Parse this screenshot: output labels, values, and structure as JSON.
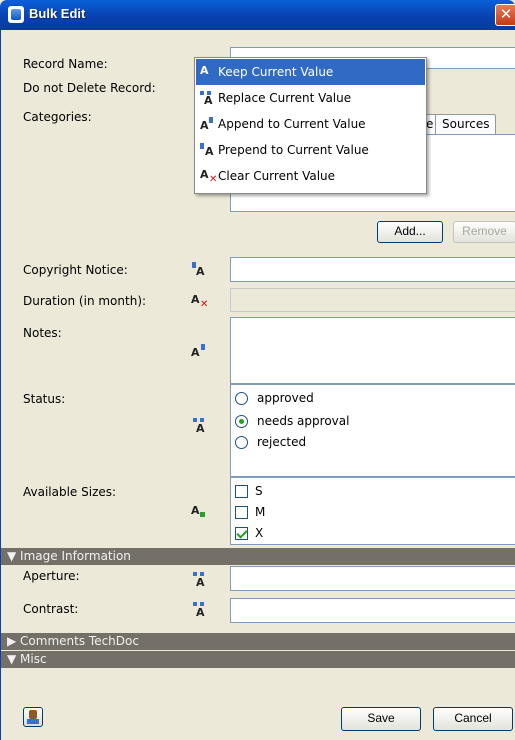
{
  "window": {
    "title": "Bulk Edit",
    "close_glyph": "✕"
  },
  "fields": {
    "record_name": "Record Name:",
    "do_not_delete": "Do not Delete Record:",
    "categories": "Categories:",
    "copyright_notice": "Copyright Notice:",
    "duration": "Duration (in month):",
    "notes": "Notes:",
    "status": "Status:",
    "available_sizes": "Available Sizes:",
    "aperture": "Aperture:",
    "contrast": "Contrast:"
  },
  "categories_panel": {
    "tab_sources": "Sources",
    "tab_partial": "e",
    "add_button": "Add...",
    "remove_button": "Remove"
  },
  "status_options": [
    {
      "label": "approved",
      "selected": false
    },
    {
      "label": "needs approval",
      "selected": true
    },
    {
      "label": "rejected",
      "selected": false
    }
  ],
  "size_options": [
    {
      "label": "S",
      "checked": false
    },
    {
      "label": "M",
      "checked": false
    },
    {
      "label": "X",
      "checked": true
    }
  ],
  "sections": {
    "image_information": "▼ Image Information",
    "comments_techdoc": "▶ Comments TechDoc",
    "misc": "▼ Misc"
  },
  "mode_menu": {
    "items": [
      {
        "label": "Keep Current Value",
        "icon": "keep-value-icon"
      },
      {
        "label": "Replace Current Value",
        "icon": "replace-value-icon"
      },
      {
        "label": "Append to Current Value",
        "icon": "append-value-icon"
      },
      {
        "label": "Prepend to Current Value",
        "icon": "prepend-value-icon"
      },
      {
        "label": "Clear Current Value",
        "icon": "clear-value-icon"
      }
    ],
    "selected_index": 0
  },
  "footer": {
    "save_button": "Save",
    "cancel_button": "Cancel"
  },
  "colors": {
    "titlebar": "#0842b0",
    "selection": "#316ac5",
    "section_bar": "#747067",
    "window_bg": "#ece9d8"
  }
}
